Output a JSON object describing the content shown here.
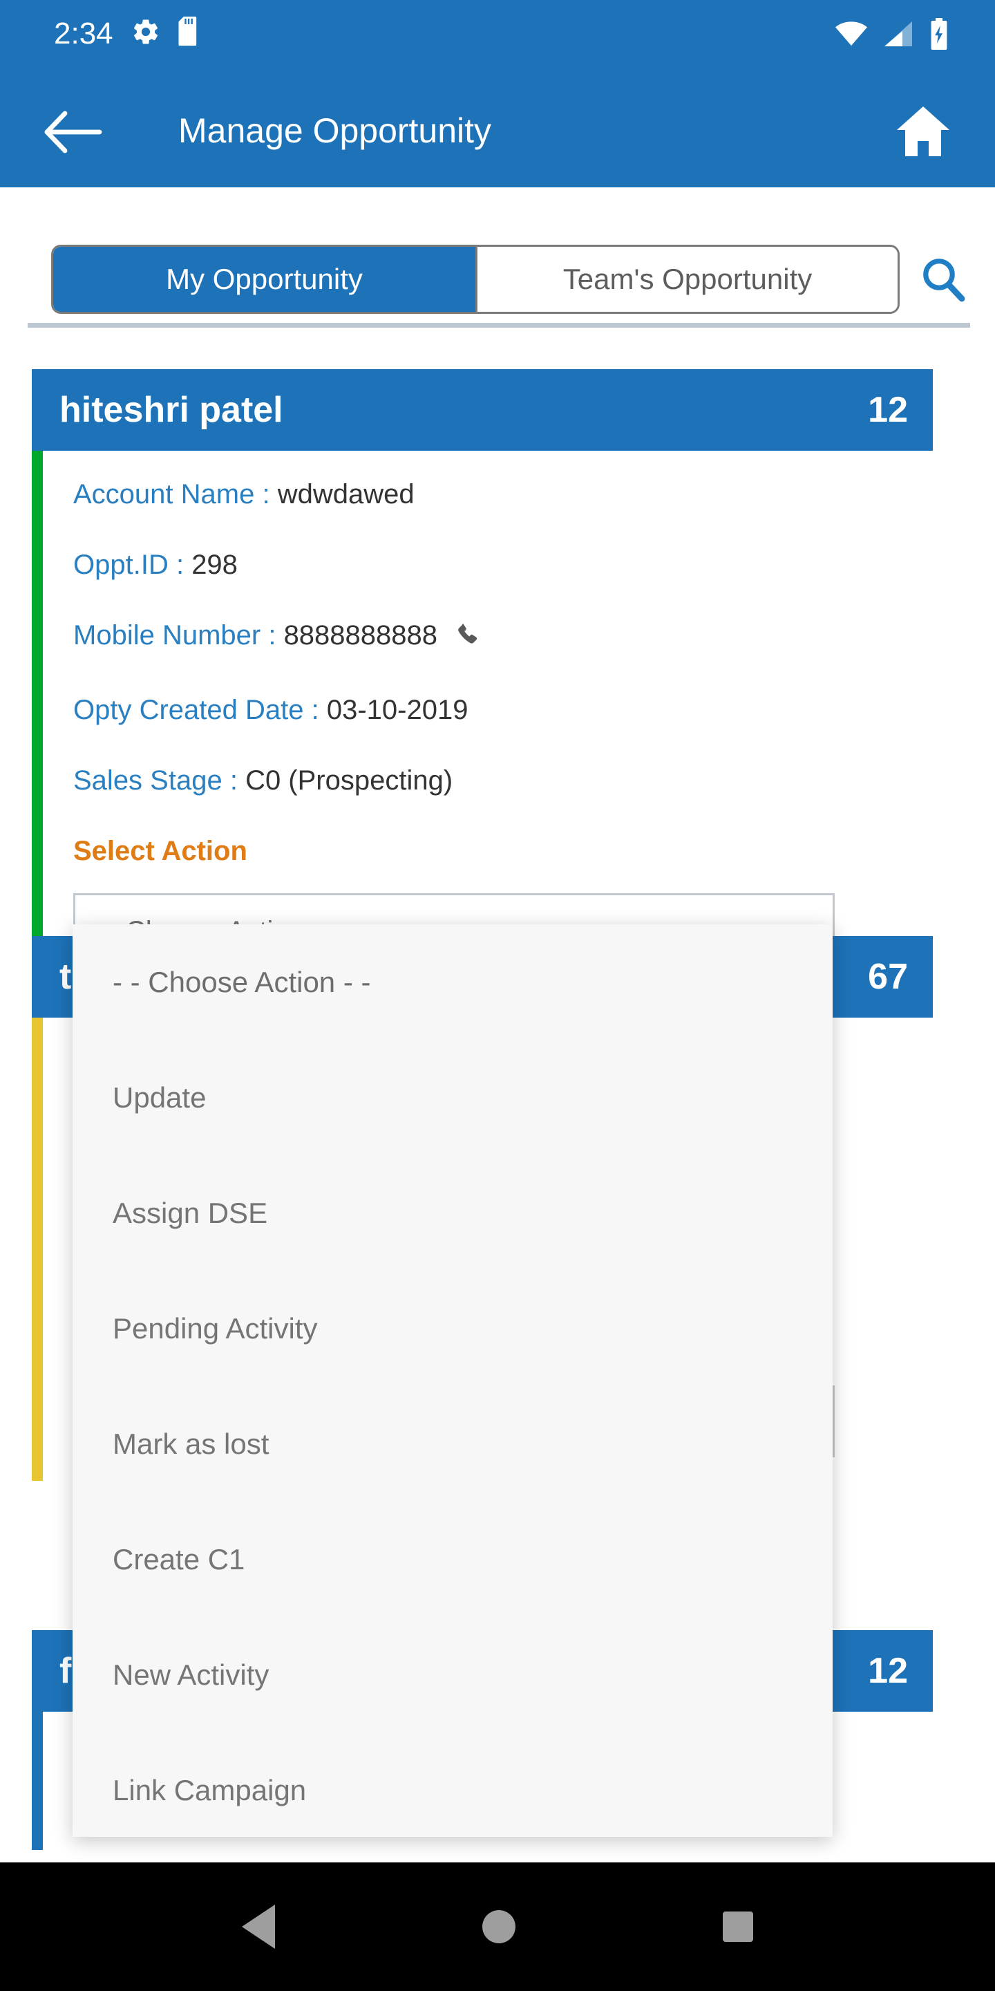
{
  "theme": {
    "primary": "#1d72b8",
    "label_blue": "#2a7fc1",
    "orange": "#e07c15",
    "menu_gray": "#757575",
    "accent_green": "#00a82d",
    "accent_yellow": "#e8c530",
    "spinner_triangle": "#29abe2",
    "navbar_black": "#000000"
  },
  "statusbar": {
    "time": "2:34",
    "left_icons": [
      "gear-icon",
      "sd-card-icon"
    ],
    "right_icons": [
      "wifi-icon",
      "signal-icon",
      "battery-charging-icon"
    ]
  },
  "appbar": {
    "back_icon": "back-arrow-icon",
    "title": "Manage Opportunity",
    "home_icon": "home-icon"
  },
  "tabs": {
    "items": [
      {
        "label": "My Opportunity",
        "active": true
      },
      {
        "label": "Team's Opportunity",
        "active": false
      }
    ],
    "search_icon": "search-icon"
  },
  "labels": {
    "account_name": "Account Name :",
    "oppt_id": "Oppt.ID :",
    "mobile_number": "Mobile Number :",
    "opty_created_date": "Opty Created Date :",
    "sales_stage": "Sales Stage :",
    "select_action": "Select Action",
    "phone_icon": "phone-icon"
  },
  "cards": [
    {
      "title": "hiteshri patel",
      "count": "12",
      "accent": "#00a82d",
      "account_name": "wdwdawed",
      "oppt_id": "298",
      "mobile_number": "8888888888",
      "opty_created_date": "03-10-2019",
      "sales_stage": "C0 (Prospecting)",
      "action_value": "- - Choose Action - -"
    },
    {
      "title": "t",
      "count": "67",
      "accent": "#e8c530",
      "account_name": "",
      "oppt_id": "",
      "mobile_number": "",
      "opty_created_date": "",
      "sales_stage": "",
      "action_value": "- - Choose Action - -"
    },
    {
      "title": "f",
      "count": "12",
      "accent": "#1d72b8",
      "account_name": "",
      "oppt_id": "",
      "mobile_number": "",
      "opty_created_date": "",
      "sales_stage": "",
      "action_value": "- - Choose Action - -"
    }
  ],
  "action_dropdown": {
    "open": true,
    "options": [
      "- - Choose Action - -",
      "Update",
      "Assign DSE",
      "Pending Activity",
      "Mark as lost",
      "Create C1",
      "New Activity",
      "Link Campaign"
    ]
  },
  "navbar": {
    "back": "nav-back-icon",
    "home": "nav-home-icon",
    "recents": "nav-recents-icon"
  }
}
